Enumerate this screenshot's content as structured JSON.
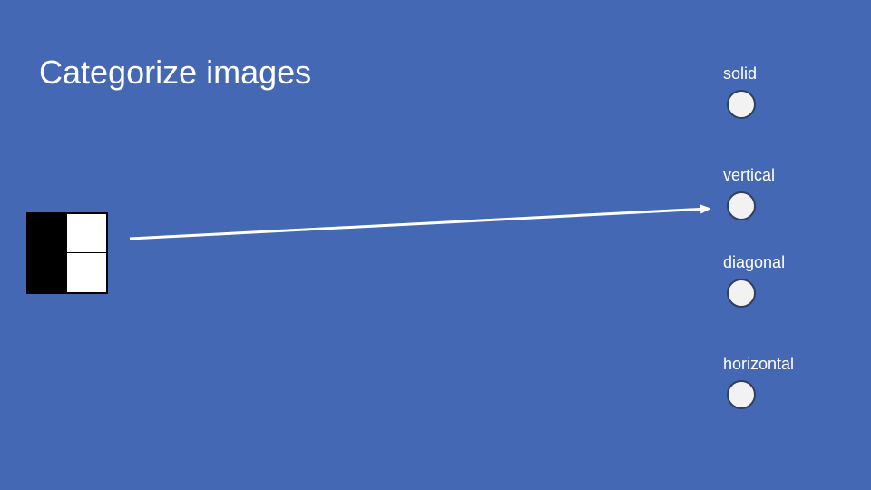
{
  "title": "Categorize images",
  "pattern": {
    "cells": [
      "black",
      "white",
      "black",
      "white"
    ],
    "colors": {
      "black": "#000000",
      "white": "#ffffff"
    }
  },
  "categories": [
    {
      "label": "solid"
    },
    {
      "label": "vertical"
    },
    {
      "label": "diagonal"
    },
    {
      "label": "horizontal"
    }
  ],
  "arrow": {
    "from": "pattern",
    "to": "vertical",
    "color": "#ffffff"
  }
}
